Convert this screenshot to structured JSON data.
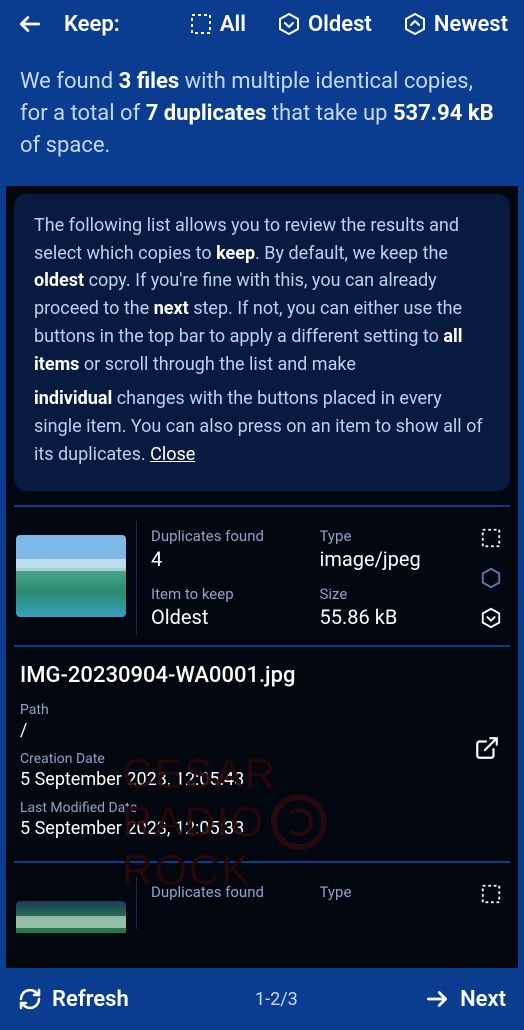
{
  "topbar": {
    "keep_label": "Keep:",
    "all": "All",
    "oldest": "Oldest",
    "newest": "Newest"
  },
  "summary": {
    "pre": "We found ",
    "files_count": "3 files",
    "mid1": " with multiple identical copies, for a total of ",
    "dupes_count": "7 duplicates",
    "mid2": " that take up ",
    "size": "537.94 kB",
    "post": " of space."
  },
  "info": {
    "p1_a": "The following list allows you to review the results and select which copies to ",
    "p1_keep": "keep",
    "p1_b": ". By default, we keep the ",
    "p1_oldest": "oldest",
    "p1_c": " copy. If you're fine with this, you can already proceed to the ",
    "p1_next": "next",
    "p1_d": " step. If not, you can either use the buttons in the top bar to apply a different setting to ",
    "p1_all": "all items",
    "p1_e": " or scroll through the list and make ",
    "p2_ind": "individual",
    "p2_a": " changes with the buttons placed in every single item. You can also press on an item to show all of its duplicates. ",
    "close": "Close"
  },
  "item1": {
    "dupes_label": "Duplicates found",
    "dupes_value": "4",
    "type_label": "Type",
    "type_value": "image/jpeg",
    "keep_label": "Item to keep",
    "keep_value": "Oldest",
    "size_label": "Size",
    "size_value": "55.86 kB"
  },
  "detail": {
    "filename": "IMG-20230904-WA0001.jpg",
    "path_label": "Path",
    "path_value": "/",
    "created_label": "Creation Date",
    "created_value": "5 September 2023, 12:05:43",
    "modified_label": "Last Modified Date",
    "modified_value": "5 September 2023, 12:05:33"
  },
  "item2": {
    "dupes_label": "Duplicates found",
    "type_label": "Type"
  },
  "bottom": {
    "refresh": "Refresh",
    "page": "1-2/3",
    "next": "Next"
  },
  "watermark": {
    "l1": "CESAR",
    "l2": "RADIO",
    "l3": "ROCK"
  }
}
